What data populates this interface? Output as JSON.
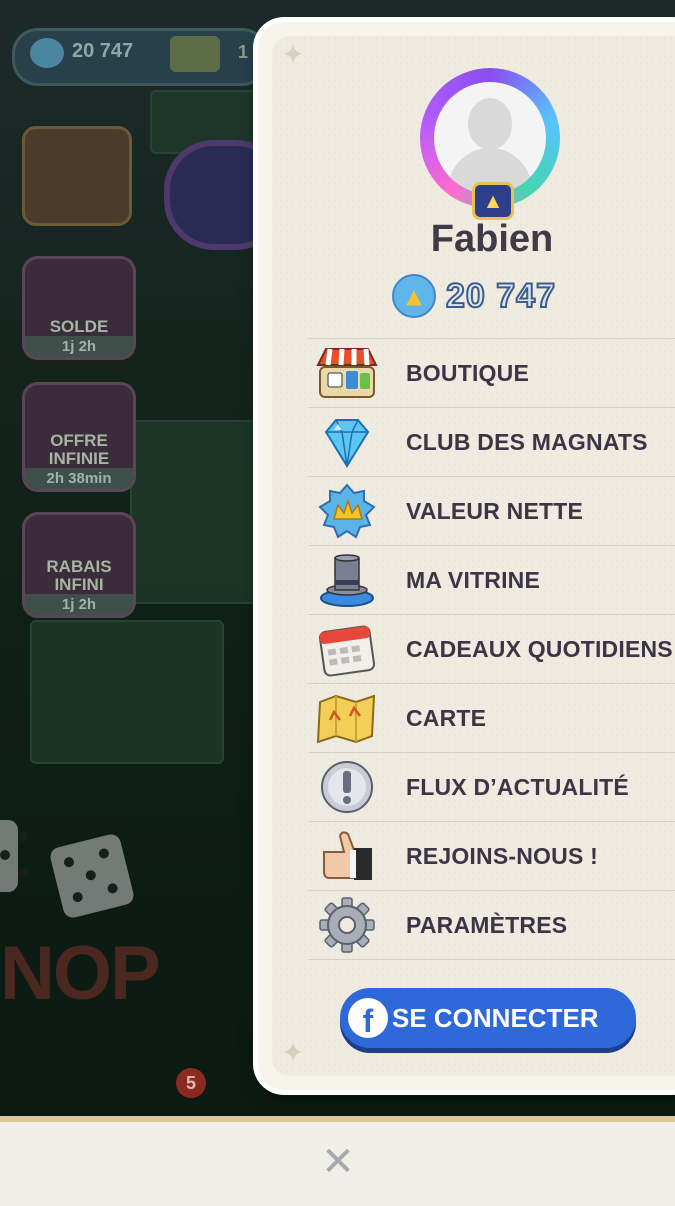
{
  "background": {
    "hud_currency_value": "20 747",
    "hud_partial_text": "1",
    "side_buttons": [
      {
        "label": "SOLDE",
        "timer": "1j 2h"
      },
      {
        "label": "OFFRE\nINFINIE",
        "timer": "2h 38min"
      },
      {
        "label": "RABAIS\nINFINI",
        "timer": "1j 2h"
      }
    ],
    "logo_partial": "NOP",
    "notification_count": "5"
  },
  "profile": {
    "name": "Fabien",
    "net_worth": "20 747",
    "net_worth_icon": "net-worth-icon",
    "avatar_icon": "default-avatar-icon"
  },
  "menu": {
    "items": [
      {
        "label": "BOUTIQUE",
        "icon": "shop-icon"
      },
      {
        "label": "CLUB DES MAGNATS",
        "icon": "diamond-icon"
      },
      {
        "label": "VALEUR NETTE",
        "icon": "net-worth-icon"
      },
      {
        "label": "MA VITRINE",
        "icon": "top-hat-icon"
      },
      {
        "label": "CADEAUX QUOTIDIENS",
        "icon": "calendar-icon"
      },
      {
        "label": "CARTE",
        "icon": "map-icon"
      },
      {
        "label": "FLUX D’ACTUALITÉ",
        "icon": "alert-icon"
      },
      {
        "label": "REJOINS-NOUS !",
        "icon": "thumbs-up-icon"
      },
      {
        "label": "PARAMÈTRES",
        "icon": "gear-icon"
      }
    ]
  },
  "facebook": {
    "label": "SE CONNECTER",
    "logo": "f"
  },
  "close": {
    "glyph": "✕"
  },
  "colors": {
    "panel_bg": "#efebe0",
    "text": "#3b3545",
    "fb_blue": "#2f68d8"
  }
}
